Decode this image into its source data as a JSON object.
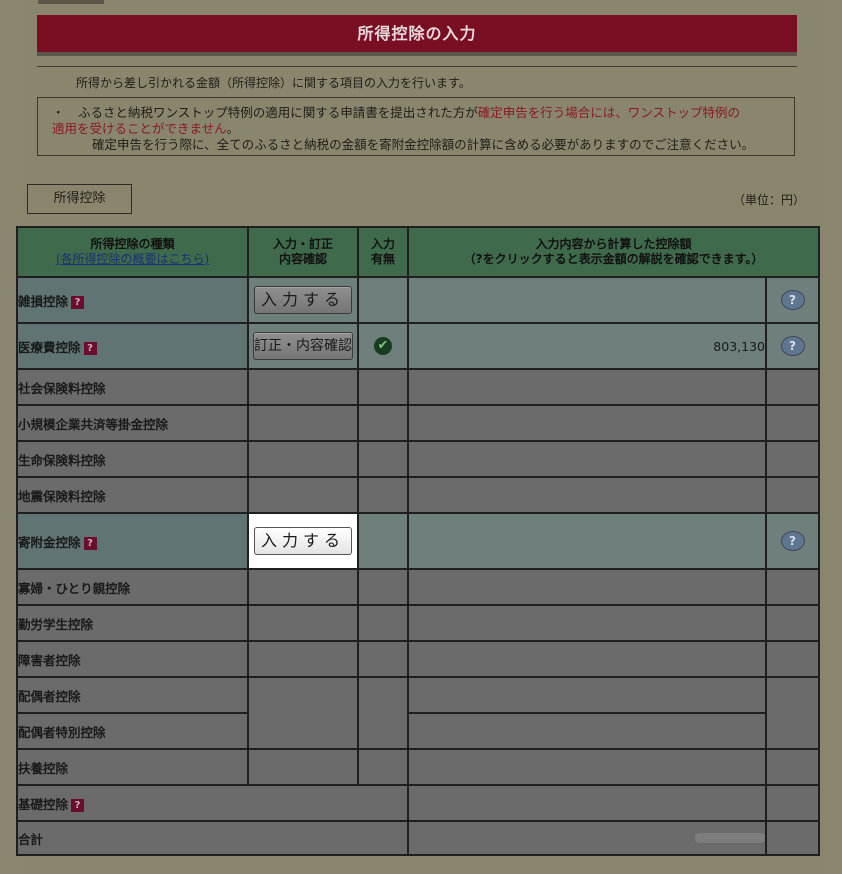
{
  "title": "所得控除の入力",
  "intro": "所得から差し引かれる金額（所得控除）に関する項目の入力を行います。",
  "notice": {
    "bullet": "・",
    "line1_black": "ふるさと納税ワンストップ特例の適用に関する申請書を提出された方が",
    "line1_red": "確定申告を行う場合には、ワンストップ特例の",
    "line2_red": "適用を受けることができません",
    "line2_black": "。",
    "line3": "確定申告を行う際に、全てのふるさと納税の金額を寄附金控除額の計算に含める必要がありますのでご注意ください。"
  },
  "tab_label": "所得控除",
  "unit": "（単位：円）",
  "headers": {
    "type": "所得控除の種類",
    "type_link": "(各所得控除の概要はこちら)",
    "input_1": "入力・訂正",
    "input_2": "内容確認",
    "status_1": "入力",
    "status_2": "有無",
    "amount_1": "入力内容から計算した控除額",
    "amount_2": "（?をクリックすると表示金額の解説を確認できます。）"
  },
  "rows": [
    {
      "name": "雑損控除"
    },
    {
      "name": "医療費控除",
      "amount": "803,130"
    },
    {
      "name": "社会保険料控除"
    },
    {
      "name": "小規模企業共済等掛金控除"
    },
    {
      "name": "生命保険料控除"
    },
    {
      "name": "地震保険料控除"
    },
    {
      "name": "寄附金控除"
    },
    {
      "name": "寡婦・ひとり親控除"
    },
    {
      "name": "勤労学生控除"
    },
    {
      "name": "障害者控除"
    },
    {
      "name": "配偶者控除"
    },
    {
      "name": "配偶者特別控除"
    },
    {
      "name": "扶養控除"
    },
    {
      "name": "基礎控除"
    },
    {
      "name": "合計"
    }
  ],
  "buttons": {
    "input": "入力する",
    "correct": "訂正・内容確認"
  },
  "icons": {
    "help": "?",
    "check": "✔",
    "qmark": "?"
  }
}
